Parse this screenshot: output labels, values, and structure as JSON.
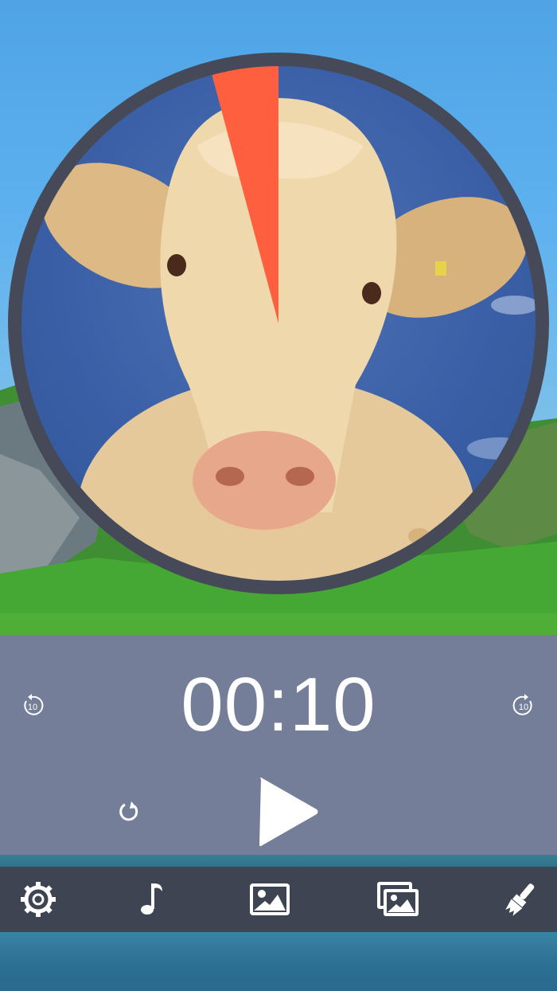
{
  "timer": {
    "display": "00:10",
    "remaining_fraction": 0.0417,
    "accent_color": "#fe5f3f"
  },
  "controls": {
    "skip_back_label": "10",
    "skip_forward_label": "10",
    "reset_icon": "reset-icon",
    "play_icon": "play-icon"
  },
  "toolbar": {
    "items": [
      "gear-icon",
      "music-note-icon",
      "image-icon",
      "gallery-icon",
      "paintbrush-icon"
    ]
  },
  "colors": {
    "panel": "#747e99",
    "toolbar": "#3f4452",
    "dial_ring": "#464a58"
  }
}
